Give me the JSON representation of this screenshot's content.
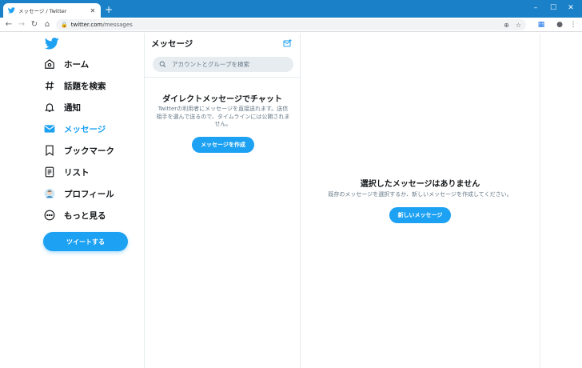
{
  "browser": {
    "tab_title": "メッセージ / Twitter",
    "tab_close": "✕",
    "new_tab": "+",
    "url_domain": "twitter.com",
    "url_path": "/messages",
    "window_min": "–",
    "window_max": "☐",
    "window_close": "✕"
  },
  "nav": {
    "items": [
      {
        "label": "ホーム",
        "icon": "home-icon"
      },
      {
        "label": "話題を検索",
        "icon": "hashtag-icon"
      },
      {
        "label": "通知",
        "icon": "bell-icon"
      },
      {
        "label": "メッセージ",
        "icon": "mail-icon"
      },
      {
        "label": "ブックマーク",
        "icon": "bookmark-icon"
      },
      {
        "label": "リスト",
        "icon": "list-icon"
      },
      {
        "label": "プロフィール",
        "icon": "avatar-icon"
      },
      {
        "label": "もっと見る",
        "icon": "more-icon"
      }
    ],
    "active_index": 3,
    "tweet_button": "ツイートする"
  },
  "messages": {
    "title": "メッセージ",
    "search_placeholder": "アカウントとグループを検索",
    "empty_title": "ダイレクトメッセージでチャット",
    "empty_desc": "Twitterの利用者にメッセージを直接送れます。送信相手を選んで送るので、タイムラインには公開されません。",
    "write_button": "メッセージを作成"
  },
  "detail": {
    "title": "選択したメッセージはありません",
    "desc": "既存のメッセージを選択するか、新しいメッセージを作成してください。",
    "new_button": "新しいメッセージ"
  },
  "colors": {
    "brand": "#1da1f2",
    "chrome_blue": "#1a81c8"
  }
}
